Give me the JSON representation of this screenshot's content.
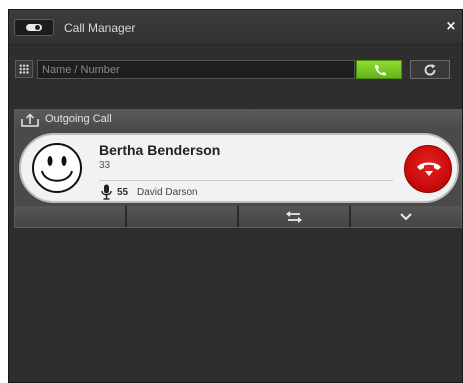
{
  "window": {
    "title": "Call Manager",
    "close_label": "×"
  },
  "dialer": {
    "placeholder": "Name / Number",
    "value": ""
  },
  "call": {
    "section_label": "Outgoing Call",
    "caller_name": "Bertha Benderson",
    "caller_number": "33",
    "extension_number": "55",
    "extension_name": "David Darson"
  },
  "icons": {
    "toggle": "toggle-icon",
    "keypad": "keypad-icon",
    "call": "phone-call-icon",
    "refresh": "refresh-icon",
    "outgoing": "outgoing-call-icon",
    "avatar": "smiley-avatar-icon",
    "mic": "microphone-icon",
    "hangup": "hang-up-icon",
    "transfer": "transfer-icon",
    "expand": "chevron-down-icon"
  },
  "colors": {
    "call_button": "#7ac428",
    "hangup_button": "#d40e0e",
    "window_bg": "#2e2e2e"
  }
}
